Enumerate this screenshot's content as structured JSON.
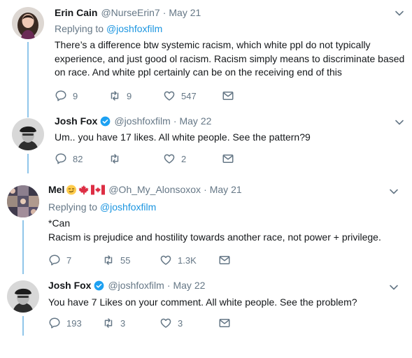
{
  "colors": {
    "name": "#14171a",
    "meta": "#657786",
    "link": "#1b95e0",
    "thread": "#90c6ea"
  },
  "tweets": [
    {
      "name": "Erin Cain",
      "handle": "@NurseErin7",
      "dot": "·",
      "date": "May 21",
      "replying_prefix": "Replying to ",
      "replying_to": "@joshfoxfilm",
      "lines": [
        "There’s a difference btw systemic racism, which white ppl do not typically",
        "experience, and just good ol racism. Racism simply means to discriminate based",
        "on race. And white ppl certainly can be on the receiving end of this"
      ],
      "replies": "9",
      "retweets": "9",
      "likes": "547"
    },
    {
      "name": "Josh Fox",
      "handle": "@joshfoxfilm",
      "dot": "·",
      "date": "May 22",
      "lines": [
        "Um.. you have 17 likes.  All white people. See the pattern?9"
      ],
      "replies": "82",
      "retweets": "",
      "likes": "2"
    },
    {
      "name": "Mel",
      "handle": "@Oh_My_Alonsoxox",
      "dot": "·",
      "date": "May 21",
      "replying_prefix": "Replying to ",
      "replying_to": "@joshfoxfilm",
      "lines": [
        "*Can",
        "Racism is prejudice and hostility towards another race, not power + privilege."
      ],
      "replies": "7",
      "retweets": "55",
      "likes": "1.3K"
    },
    {
      "name": "Josh Fox",
      "handle": "@joshfoxfilm",
      "dot": "·",
      "date": "May 22",
      "lines": [
        "You have 7 Likes on your comment.  All white people. See the problem?"
      ],
      "replies": "193",
      "retweets": "3",
      "likes": "3"
    }
  ],
  "icons": [
    "reply-icon",
    "retweet-icon",
    "like-icon",
    "message-icon",
    "chevron-down-icon",
    "verified-icon"
  ]
}
